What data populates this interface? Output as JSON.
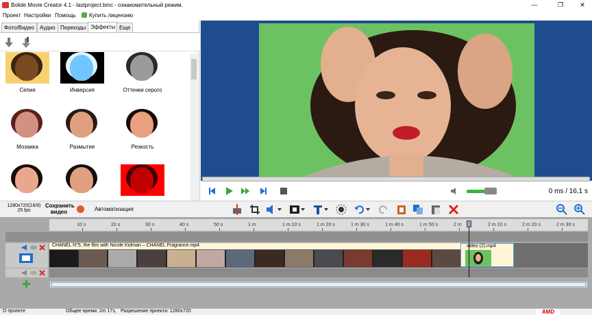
{
  "window": {
    "title": "Bolide Movie Creator 4.1 - lastproject.bmc - ознакомительный режим.",
    "minimize": "—",
    "maximize": "❐",
    "close": "✕"
  },
  "menu": {
    "items": [
      "Проект",
      "Настройки",
      "Помощь"
    ],
    "buy_license": "Купить лицензию"
  },
  "tabs": [
    {
      "label": "Фото/Видео",
      "active": false
    },
    {
      "label": "Аудио",
      "active": false
    },
    {
      "label": "Переходы",
      "active": false
    },
    {
      "label": "Эффекты",
      "active": true
    },
    {
      "label": "Еще",
      "active": false
    }
  ],
  "effects": [
    {
      "label": "Сепия",
      "bg": "#f7d070",
      "face": "#7a4a20",
      "hair": "#3b2410"
    },
    {
      "label": "Инверсия",
      "bg": "#000000",
      "face": "#70c6ff",
      "hair": "#e0f4ff"
    },
    {
      "label": "Оттенки серого",
      "bg": "#ffffff",
      "face": "#9a9a9a",
      "hair": "#2a2a2a"
    },
    {
      "label": "Мозаика",
      "bg": "#ffffff",
      "face": "#d49080",
      "hair": "#5a2020"
    },
    {
      "label": "Размытие",
      "bg": "#ffffff",
      "face": "#e0a080",
      "hair": "#2a1a10"
    },
    {
      "label": "Резкость",
      "bg": "#ffffff",
      "face": "#e8a080",
      "hair": "#1a0a05"
    },
    {
      "label": "",
      "bg": "#ffffff",
      "face": "#e8a890",
      "hair": "#1a0a05"
    },
    {
      "label": "",
      "bg": "#ffffff",
      "face": "#e0a080",
      "hair": "#101010"
    },
    {
      "label": "",
      "bg": "#ff0000",
      "face": "#c00000",
      "hair": "#400000"
    }
  ],
  "player": {
    "time": "0 ms  / 16,1 s"
  },
  "project": {
    "resolution": "1280x720(16/9)",
    "fps": "25 fps",
    "save_video": "Сохранить видео",
    "automation": "Автоматизация"
  },
  "timeline": {
    "ticks": [
      "10 s",
      "20 s",
      "30 s",
      "40 s",
      "50 s",
      "1 m",
      "1 m 10 s",
      "1 m 20 s",
      "1 m 30 s",
      "1 m 40 s",
      "1 m 50 s",
      "2 m",
      "2 m 10 s",
      "2 m 20 s",
      "2 m 30 s"
    ],
    "clip1": "CHANEL N°5, the film with Nicole Kidman – CHANEL Fragrance.mp4",
    "clip2": "video (2).mp4",
    "frame_colors": [
      "#1a1a1a",
      "#6a5a50",
      "#aaaaaa",
      "#4a4040",
      "#c8b090",
      "#c0a8a0",
      "#5a6a78",
      "#3a2a20",
      "#8a7a6a",
      "#4a4a50",
      "#7a3a30",
      "#2a2a2a",
      "#9a2a20",
      "#5a4a40"
    ]
  },
  "status": {
    "project": "О проекте",
    "total_time": "Общее время: 2m 17s,",
    "resolution": "Разрешение проекта:  1280x720",
    "brand": "AMD"
  }
}
